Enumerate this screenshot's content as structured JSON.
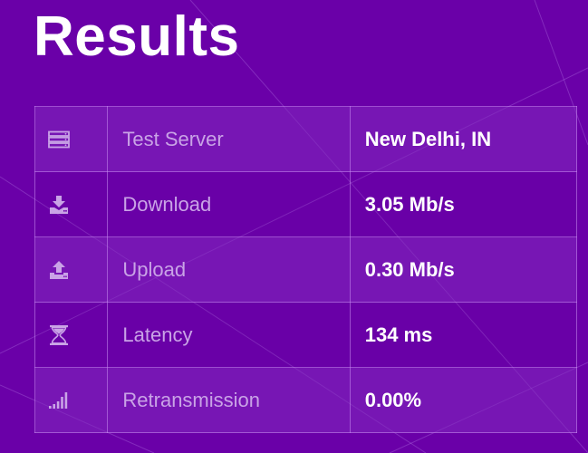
{
  "page": {
    "title": "Results"
  },
  "results": [
    {
      "icon": "server-icon",
      "label": "Test Server",
      "value": "New Delhi, IN"
    },
    {
      "icon": "download-icon",
      "label": "Download",
      "value": "3.05 Mb/s"
    },
    {
      "icon": "upload-icon",
      "label": "Upload",
      "value": "0.30 Mb/s"
    },
    {
      "icon": "hourglass-icon",
      "label": "Latency",
      "value": "134 ms"
    },
    {
      "icon": "signal-bars-icon",
      "label": "Retransmission",
      "value": "0.00%"
    }
  ],
  "colors": {
    "background": "#6a00a8",
    "icon": "#c9a3e6",
    "label": "#c9a3e6",
    "value": "#ffffff"
  }
}
